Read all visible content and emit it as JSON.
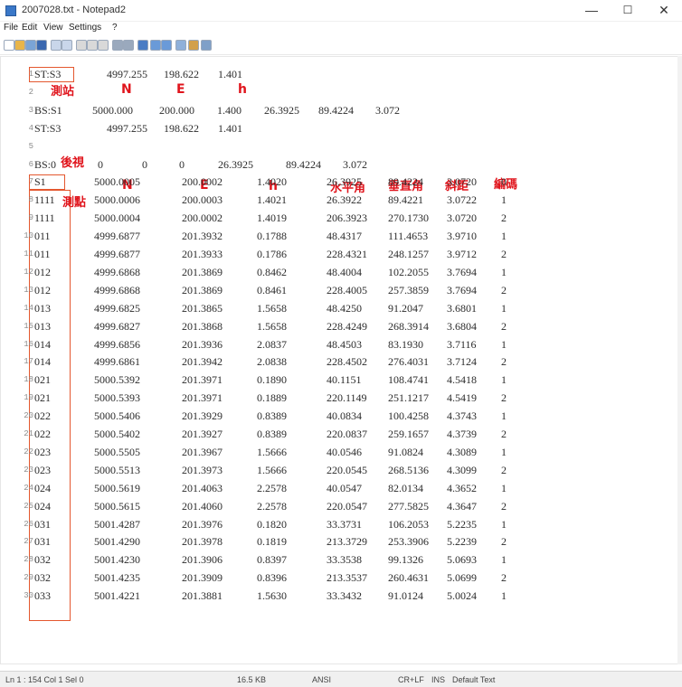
{
  "window": {
    "title": "2007028.txt - Notepad2",
    "controls": {
      "minimize": "—",
      "maximize": "☐",
      "close": "✕"
    }
  },
  "menu": [
    "File",
    "Edit",
    "View",
    "Settings",
    "?"
  ],
  "toolbar": [
    {
      "icon": "new-file-icon",
      "color": "#ffffff"
    },
    {
      "icon": "open-folder-icon",
      "color": "#e8b54a"
    },
    {
      "icon": "browse-icon",
      "color": "#7aa4d6"
    },
    {
      "icon": "save-icon",
      "color": "#3a68b0"
    },
    {
      "icon": "undo-icon",
      "color": "#c9d6ea"
    },
    {
      "icon": "redo-icon",
      "color": "#c9d6ea"
    },
    {
      "icon": "cut-icon",
      "color": "#d9d9d9"
    },
    {
      "icon": "copy-icon",
      "color": "#d9d9d9"
    },
    {
      "icon": "paste-icon",
      "color": "#d9d9d9"
    },
    {
      "icon": "find-icon",
      "color": "#9aa9bd"
    },
    {
      "icon": "replace-icon",
      "color": "#9aa9bd"
    },
    {
      "icon": "word-wrap-icon",
      "color": "#4a7cc4"
    },
    {
      "icon": "zoom-in-icon",
      "color": "#6a9ad8"
    },
    {
      "icon": "zoom-out-icon",
      "color": "#6a9ad8"
    },
    {
      "icon": "scheme-icon",
      "color": "#8fb0da"
    },
    {
      "icon": "settings-icon",
      "color": "#d2a04a"
    },
    {
      "icon": "exit-icon",
      "color": "#7fa0c8"
    }
  ],
  "lines": [
    {
      "n": "1",
      "cols": [
        "ST:S3",
        "4997.255",
        "198.622",
        "1.401",
        "",
        "",
        "",
        ""
      ]
    },
    {
      "n": "2",
      "cols": [
        "",
        "",
        "",
        "",
        "",
        "",
        "",
        ""
      ]
    },
    {
      "n": "3",
      "cols": [
        "BS:S1",
        "5000.000",
        "200.000",
        "1.400",
        "26.3925",
        "89.4224",
        "3.072",
        ""
      ]
    },
    {
      "n": "4",
      "cols": [
        "ST:S3",
        "4997.255",
        "198.622",
        "1.401",
        "",
        "",
        "",
        ""
      ]
    },
    {
      "n": "5",
      "cols": [
        "",
        "",
        "",
        "",
        "",
        "",
        "",
        ""
      ]
    },
    {
      "n": "6",
      "cols": [
        "BS:0",
        "0",
        "0",
        "0",
        "26.3925",
        "89.4224",
        "3.072",
        ""
      ]
    },
    {
      "n": "7",
      "cols": [
        "S1",
        "5000.0005",
        "200.0002",
        "1.4020",
        "26.3925",
        "89.4224",
        "3.0720",
        "0"
      ]
    },
    {
      "n": "8",
      "cols": [
        "1111",
        "5000.0006",
        "200.0003",
        "1.4021",
        "26.3922",
        "89.4221",
        "3.0722",
        "1"
      ]
    },
    {
      "n": "9",
      "cols": [
        "1111",
        "5000.0004",
        "200.0002",
        "1.4019",
        "206.3923",
        "270.1730",
        "3.0720",
        "2"
      ]
    },
    {
      "n": "10",
      "cols": [
        "011",
        "4999.6877",
        "201.3932",
        "0.1788",
        "48.4317",
        "111.4653",
        "3.9710",
        "1"
      ]
    },
    {
      "n": "11",
      "cols": [
        "011",
        "4999.6877",
        "201.3933",
        "0.1786",
        "228.4321",
        "248.1257",
        "3.9712",
        "2"
      ]
    },
    {
      "n": "12",
      "cols": [
        "012",
        "4999.6868",
        "201.3869",
        "0.8462",
        "48.4004",
        "102.2055",
        "3.7694",
        "1"
      ]
    },
    {
      "n": "13",
      "cols": [
        "012",
        "4999.6868",
        "201.3869",
        "0.8461",
        "228.4005",
        "257.3859",
        "3.7694",
        "2"
      ]
    },
    {
      "n": "14",
      "cols": [
        "013",
        "4999.6825",
        "201.3865",
        "1.5658",
        "48.4250",
        "91.2047",
        "3.6801",
        "1"
      ]
    },
    {
      "n": "15",
      "cols": [
        "013",
        "4999.6827",
        "201.3868",
        "1.5658",
        "228.4249",
        "268.3914",
        "3.6804",
        "2"
      ]
    },
    {
      "n": "16",
      "cols": [
        "014",
        "4999.6856",
        "201.3936",
        "2.0837",
        "48.4503",
        "83.1930",
        "3.7116",
        "1"
      ]
    },
    {
      "n": "17",
      "cols": [
        "014",
        "4999.6861",
        "201.3942",
        "2.0838",
        "228.4502",
        "276.4031",
        "3.7124",
        "2"
      ]
    },
    {
      "n": "18",
      "cols": [
        "021",
        "5000.5392",
        "201.3971",
        "0.1890",
        "40.1151",
        "108.4741",
        "4.5418",
        "1"
      ]
    },
    {
      "n": "19",
      "cols": [
        "021",
        "5000.5393",
        "201.3971",
        "0.1889",
        "220.1149",
        "251.1217",
        "4.5419",
        "2"
      ]
    },
    {
      "n": "20",
      "cols": [
        "022",
        "5000.5406",
        "201.3929",
        "0.8389",
        "40.0834",
        "100.4258",
        "4.3743",
        "1"
      ]
    },
    {
      "n": "21",
      "cols": [
        "022",
        "5000.5402",
        "201.3927",
        "0.8389",
        "220.0837",
        "259.1657",
        "4.3739",
        "2"
      ]
    },
    {
      "n": "22",
      "cols": [
        "023",
        "5000.5505",
        "201.3967",
        "1.5666",
        "40.0546",
        "91.0824",
        "4.3089",
        "1"
      ]
    },
    {
      "n": "23",
      "cols": [
        "023",
        "5000.5513",
        "201.3973",
        "1.5666",
        "220.0545",
        "268.5136",
        "4.3099",
        "2"
      ]
    },
    {
      "n": "24",
      "cols": [
        "024",
        "5000.5619",
        "201.4063",
        "2.2578",
        "40.0547",
        "82.0134",
        "4.3652",
        "1"
      ]
    },
    {
      "n": "25",
      "cols": [
        "024",
        "5000.5615",
        "201.4060",
        "2.2578",
        "220.0547",
        "277.5825",
        "4.3647",
        "2"
      ]
    },
    {
      "n": "26",
      "cols": [
        "031",
        "5001.4287",
        "201.3976",
        "0.1820",
        "33.3731",
        "106.2053",
        "5.2235",
        "1"
      ]
    },
    {
      "n": "27",
      "cols": [
        "031",
        "5001.4290",
        "201.3978",
        "0.1819",
        "213.3729",
        "253.3906",
        "5.2239",
        "2"
      ]
    },
    {
      "n": "28",
      "cols": [
        "032",
        "5001.4230",
        "201.3906",
        "0.8397",
        "33.3538",
        "99.1326",
        "5.0693",
        "1"
      ]
    },
    {
      "n": "29",
      "cols": [
        "032",
        "5001.4235",
        "201.3909",
        "0.8396",
        "213.3537",
        "260.4631",
        "5.0699",
        "2"
      ]
    },
    {
      "n": "30",
      "cols": [
        "033",
        "5001.4221",
        "201.3881",
        "1.5630",
        "33.3432",
        "91.0124",
        "5.0024",
        "1"
      ]
    }
  ],
  "annotations": {
    "station": "測站",
    "row1_n": "N",
    "row1_e": "E",
    "row1_h": "h",
    "backsight": "後視",
    "row6_n": "N",
    "row6_e": "E",
    "row6_h": "h",
    "horizontal_angle": "水平角",
    "vertical_angle": "垂直角",
    "slope_distance": "斜距",
    "code": "編碼",
    "measured_point": "測點"
  },
  "status": {
    "position": "Ln 1 : 154   Col 1   Sel 0",
    "size": "16.5 KB",
    "encoding": "ANSI",
    "line_ending": "CR+LF",
    "mode": "INS",
    "scheme": "Default Text"
  }
}
